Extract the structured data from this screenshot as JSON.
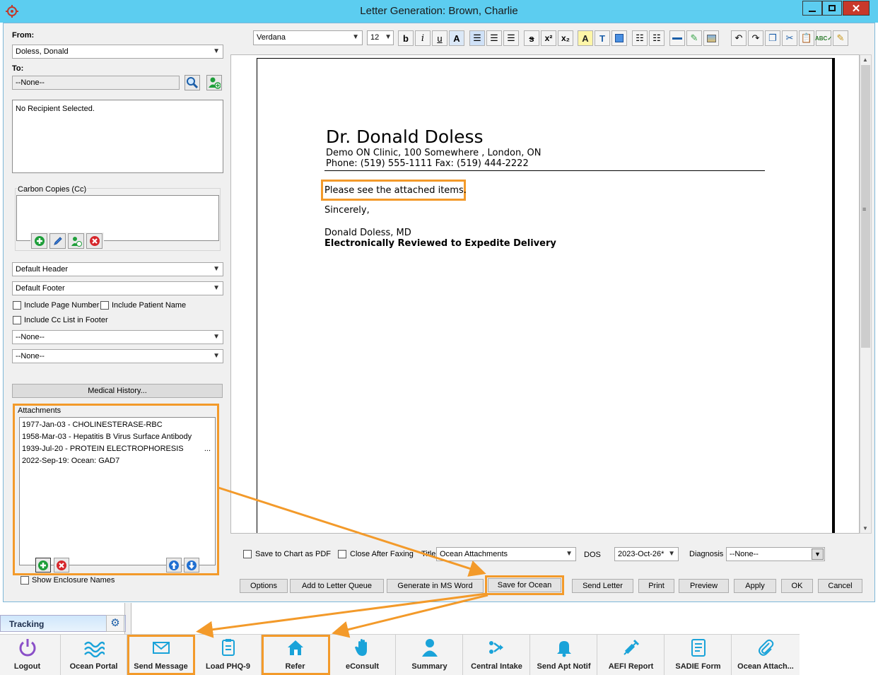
{
  "window": {
    "title": "Letter Generation: Brown, Charlie"
  },
  "from": {
    "label": "From:",
    "value": "Doless, Donald"
  },
  "to": {
    "label": "To:",
    "value": "--None--",
    "recipient_text": "No Recipient Selected."
  },
  "cc": {
    "label": "Carbon Copies (Cc)"
  },
  "header_select": "Default Header",
  "footer_select": "Default Footer",
  "options": {
    "include_page_number": "Include Page Number",
    "include_patient_name": "Include Patient Name",
    "include_cc_list": "Include Cc List in Footer"
  },
  "none_select_1": "--None--",
  "none_select_2": "--None--",
  "medical_history_button": "Medical History...",
  "attachments": {
    "label": "Attachments",
    "items": [
      "1977-Jan-03 - CHOLINESTERASE-RBC",
      "1958-Mar-03 - Hepatitis B Virus Surface Antibody",
      "1939-Jul-20 - PROTEIN ELECTROPHORESIS",
      "2022-Sep-19: Ocean: GAD7"
    ],
    "more": "..."
  },
  "show_enclosure_names": "Show Enclosure Names",
  "toolbar": {
    "font": "Verdana",
    "size": "12"
  },
  "letter": {
    "doctor": "Dr. Donald Doless",
    "clinic": "Demo ON Clinic, 100 Somewhere , London, ON",
    "phone": "Phone: (519) 555-1111 Fax: (519) 444-2222",
    "body": "Please see the attached items.",
    "closing": "Sincerely,",
    "signature": "Donald Doless, MD",
    "reviewed": "Electronically Reviewed to Expedite Delivery"
  },
  "bottom_options": {
    "save_pdf": "Save to Chart as PDF",
    "close_fax": "Close After Faxing",
    "title_label": "Title",
    "title_value": "Ocean Attachments",
    "dos_label": "DOS",
    "dos_value": "2023-Oct-26*",
    "diagnosis_label": "Diagnosis",
    "diagnosis_value": "--None--"
  },
  "actions": {
    "options": "Options",
    "add_queue": "Add to Letter Queue",
    "ms_word": "Generate in MS Word",
    "save_ocean": "Save for Ocean",
    "send_letter": "Send Letter",
    "print": "Print",
    "preview": "Preview",
    "apply": "Apply",
    "ok": "OK",
    "cancel": "Cancel"
  },
  "tracking": {
    "label": "Tracking"
  },
  "dock": [
    "Logout",
    "Ocean Portal",
    "Send Message",
    "Load PHQ-9",
    "Refer",
    "eConsult",
    "Summary",
    "Central Intake",
    "Send Apt Notif",
    "AEFI Report",
    "SADIE Form",
    "Ocean Attach..."
  ],
  "colors": {
    "titlebar": "#5ccdf0",
    "highlight": "#f39a2a",
    "dock_icon": "#1aa3d9"
  }
}
